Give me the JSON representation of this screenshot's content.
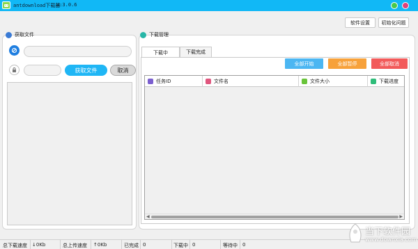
{
  "window": {
    "title": "antdownload下载器",
    "version": "V:3.0.6"
  },
  "top_buttons": {
    "settings": "软件设置",
    "init_problem": "初始化问题"
  },
  "left_panel": {
    "title": "获取文件",
    "fetch_button": "获取文件",
    "cancel_button": "取消"
  },
  "right_panel": {
    "title": "下载管理",
    "tabs": [
      "下载中",
      "下载完成"
    ],
    "actions": {
      "start_all": "全部开始",
      "pause_all": "全部暂停",
      "cancel_all": "全部取消"
    },
    "columns": [
      "任务ID",
      "文件名",
      "文件大小",
      "下载进度"
    ]
  },
  "status_bar": {
    "download_speed_label": "总下载速度",
    "download_speed_value": "↓0Kb",
    "upload_speed_label": "总上传速度",
    "upload_speed_value": "↑0Kb",
    "completed_label": "已完成",
    "completed_value": "0",
    "downloading_label": "下载中",
    "downloading_value": "0",
    "waiting_label": "等待中",
    "waiting_value": "0"
  },
  "watermark": {
    "text": "当下软件园",
    "url": "www.downxia.com"
  },
  "colors": {
    "titlebar": "#11b8f6",
    "start_all": "#4bb6f2",
    "pause_all": "#f7a13a",
    "cancel_all": "#f25a5a",
    "fetch_button": "#1fb6f5"
  }
}
